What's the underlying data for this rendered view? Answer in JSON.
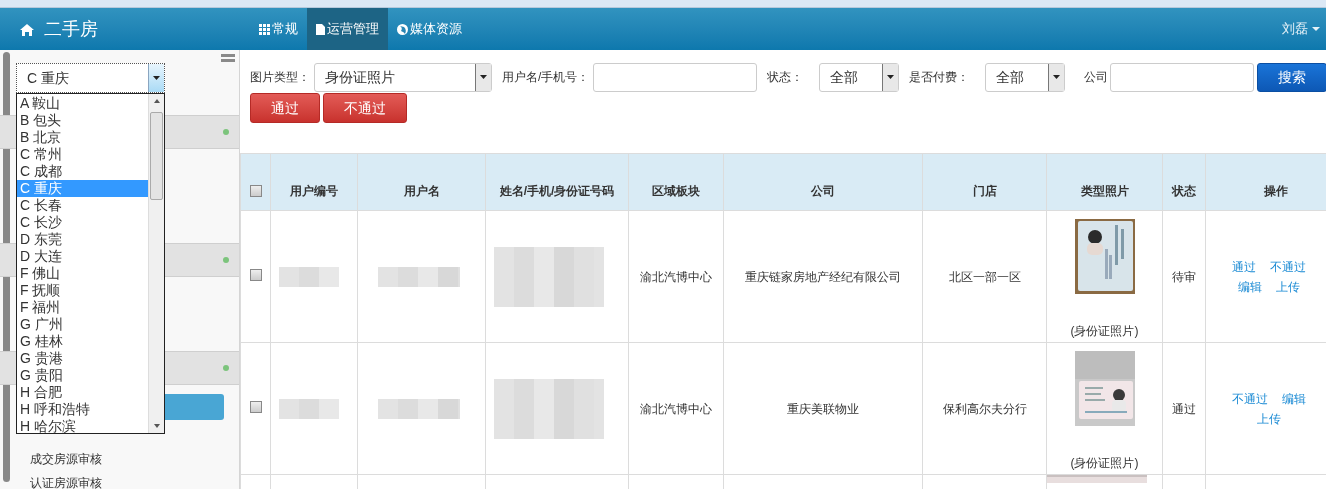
{
  "header": {
    "title": "二手房",
    "nav": [
      {
        "label": "常规",
        "selected": false
      },
      {
        "label": "运营管理",
        "selected": true
      },
      {
        "label": "媒体资源",
        "selected": false
      }
    ],
    "user": "刘磊"
  },
  "sidebar": {
    "city_select": {
      "value": "C 重庆",
      "expanded": true
    },
    "city_options": [
      {
        "label": "A 鞍山",
        "selected": false
      },
      {
        "label": "B 包头",
        "selected": false
      },
      {
        "label": "B 北京",
        "selected": false
      },
      {
        "label": "C 常州",
        "selected": false
      },
      {
        "label": "C 成都",
        "selected": false
      },
      {
        "label": "C 重庆",
        "selected": true
      },
      {
        "label": "C 长春",
        "selected": false
      },
      {
        "label": "C 长沙",
        "selected": false
      },
      {
        "label": "D 东莞",
        "selected": false
      },
      {
        "label": "D 大连",
        "selected": false
      },
      {
        "label": "F 佛山",
        "selected": false
      },
      {
        "label": "F 抚顺",
        "selected": false
      },
      {
        "label": "F 福州",
        "selected": false
      },
      {
        "label": "G 广州",
        "selected": false
      },
      {
        "label": "G 桂林",
        "selected": false
      },
      {
        "label": "G 贵港",
        "selected": false
      },
      {
        "label": "G 贵阳",
        "selected": false
      },
      {
        "label": "H 合肥",
        "selected": false
      },
      {
        "label": "H 呼和浩特",
        "selected": false
      },
      {
        "label": "H 哈尔滨",
        "selected": false
      }
    ],
    "items": [
      "成交房源审核",
      "认证房源审核"
    ]
  },
  "filters": [
    {
      "kind": "select",
      "label": "图片类型：",
      "value": "身份证照片"
    },
    {
      "kind": "input",
      "label": "用户名/手机号："
    },
    {
      "kind": "select",
      "label": "状态：",
      "value": "全部"
    },
    {
      "kind": "select",
      "label": "是否付费：",
      "value": "全部"
    },
    {
      "kind": "input",
      "label": "公司"
    }
  ],
  "search_button": "搜索",
  "bulk_actions": [
    "通过",
    "不通过"
  ],
  "table": {
    "select_all_checked": false,
    "columns": [
      "用户编号",
      "用户名",
      "姓名/手机/身份证号码",
      "区域板块",
      "公司",
      "门店",
      "类型照片",
      "状态",
      "操作"
    ],
    "rows": [
      {
        "kind": "full",
        "checked": false,
        "region": "渝北汽博中心",
        "company": "重庆链家房地产经纪有限公司",
        "store": "北区一部一区",
        "photo_caption": "(身份证照片)",
        "status": "待审",
        "actions": [
          "通过",
          "不通过",
          "编辑",
          "上传"
        ]
      },
      {
        "kind": "full",
        "checked": false,
        "region": "渝北汽博中心",
        "company": "重庆美联物业",
        "store": "保利高尔夫分行",
        "photo_caption": "(身份证照片)",
        "status": "通过",
        "actions": [
          "不通过",
          "编辑",
          "上传"
        ]
      },
      {
        "kind": "partial"
      }
    ]
  }
}
